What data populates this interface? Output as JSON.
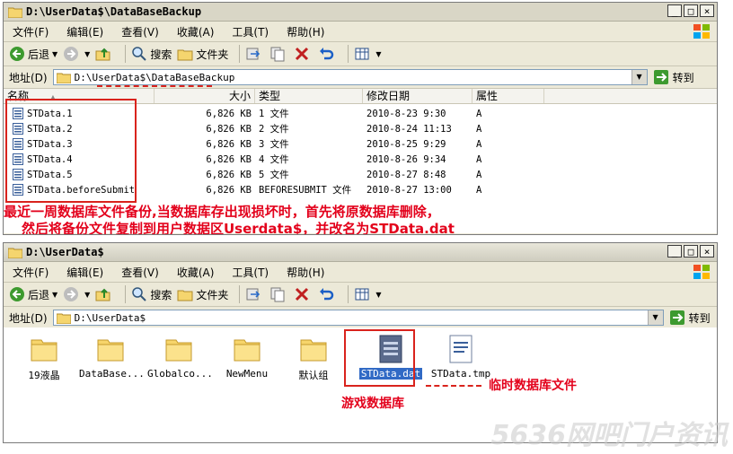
{
  "window1": {
    "title": "D:\\UserData$\\DataBaseBackup",
    "address": "D:\\UserData$\\DataBaseBackup"
  },
  "window2": {
    "title": "D:\\UserData$",
    "address": "D:\\UserData$"
  },
  "menu": {
    "file": "文件(F)",
    "edit": "编辑(E)",
    "view": "查看(V)",
    "favorites": "收藏(A)",
    "tools": "工具(T)",
    "help": "帮助(H)"
  },
  "toolbar": {
    "back": "后退",
    "search": "搜索",
    "folders": "文件夹"
  },
  "address_label": "地址(D)",
  "go_label": "转到",
  "columns": {
    "name": "名称",
    "size": "大小",
    "type": "类型",
    "modified": "修改日期",
    "attributes": "属性"
  },
  "files": [
    {
      "name": "STData.1",
      "size": "6,826 KB",
      "type": "1 文件",
      "modified": "2010-8-23 9:30",
      "attr": "A"
    },
    {
      "name": "STData.2",
      "size": "6,826 KB",
      "type": "2 文件",
      "modified": "2010-8-24 11:13",
      "attr": "A"
    },
    {
      "name": "STData.3",
      "size": "6,826 KB",
      "type": "3 文件",
      "modified": "2010-8-25 9:29",
      "attr": "A"
    },
    {
      "name": "STData.4",
      "size": "6,826 KB",
      "type": "4 文件",
      "modified": "2010-8-26 9:34",
      "attr": "A"
    },
    {
      "name": "STData.5",
      "size": "6,826 KB",
      "type": "5 文件",
      "modified": "2010-8-27 8:48",
      "attr": "A"
    },
    {
      "name": "STData.beforeSubmit",
      "size": "6,826 KB",
      "type": "BEFORESUBMIT 文件",
      "modified": "2010-8-27 13:00",
      "attr": "A"
    }
  ],
  "annotations": {
    "line1": "最近一周数据库文件备份,当数据库存出现损坏时，首先将原数据库删除，",
    "line2": "然后将备份文件复制到用户数据区Userdata$，并改名为STData.dat",
    "game_db": "游戏数据库",
    "temp_db": "临时数据库文件"
  },
  "icons": [
    {
      "label": "19液晶",
      "kind": "folder"
    },
    {
      "label": "DataBase...",
      "kind": "folder"
    },
    {
      "label": "Globalco...",
      "kind": "folder"
    },
    {
      "label": "NewMenu",
      "kind": "folder"
    },
    {
      "label": "默认组",
      "kind": "folder"
    },
    {
      "label": "STData.dat",
      "kind": "dat-file"
    },
    {
      "label": "STData.tmp",
      "kind": "tmp-file"
    }
  ],
  "watermark": "5636网吧门户资讯",
  "colors": {
    "annotation_red": "#e3001b",
    "xp_face": "#ece9d8"
  }
}
